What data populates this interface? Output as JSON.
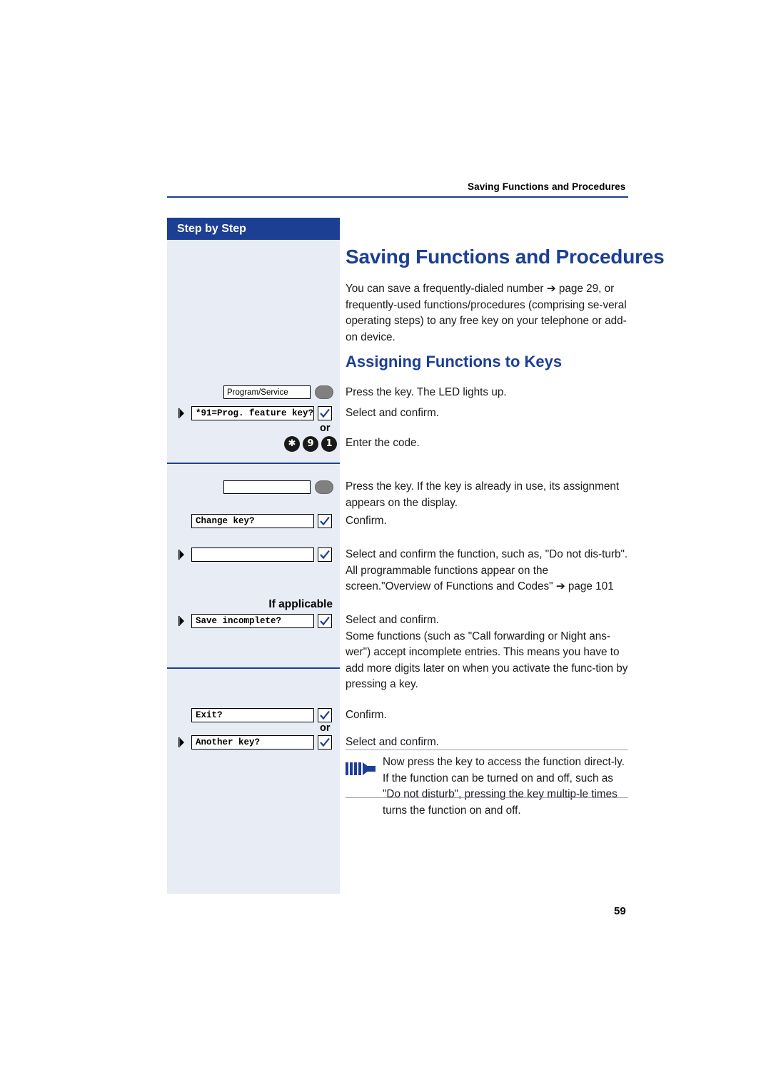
{
  "header": {
    "running_head": "Saving Functions and Procedures"
  },
  "sidebar": {
    "title": "Step by Step",
    "if_applicable": "If applicable",
    "or_1": "or",
    "or_2": "or",
    "keys": {
      "program_service": "Program/Service",
      "blank_key": "",
      "display_prog_feature": "*91=Prog. feature key?",
      "display_change_key": "Change key?",
      "display_blank": "",
      "display_save_incomplete": "Save incomplete?",
      "display_exit": "Exit?",
      "display_another_key": "Another key?",
      "code_digits": [
        "✱",
        "9",
        "1"
      ]
    }
  },
  "main": {
    "title": "Saving Functions and Procedures",
    "intro": "You can save a frequently-dialed number ➔ page 29, or frequently-used functions/procedures (comprising se-veral operating steps) to any free key on your telephone or add-on device.",
    "section_title": "Assigning Functions to Keys",
    "steps": [
      "Press the key. The LED lights up.",
      "Select and confirm.",
      "Enter the code.",
      "Press the key. If the key is already in use, its assignment appears on the display.",
      "Confirm.",
      "Select and confirm the function, such as, \"Do not dis-turb\".\nAll programmable functions appear on the screen.\"Overview of Functions and Codes\" ➔ page 101",
      "Select and confirm.\nSome functions (such as \"Call forwarding or Night ans-wer\") accept incomplete entries. This means you have to add more digits later on when you activate the func-tion by pressing a key.",
      "Confirm.",
      "Select and confirm."
    ],
    "note": "Now press the key to access the function direct-ly. If the function can be turned on and off, such as \"Do not disturb\", pressing the key multip-le times turns the function on and off.",
    "page_number": "59"
  },
  "colors": {
    "accent": "#1c3f94",
    "panel": "#e8ecf5",
    "note_arrow": "#1c3f94"
  }
}
